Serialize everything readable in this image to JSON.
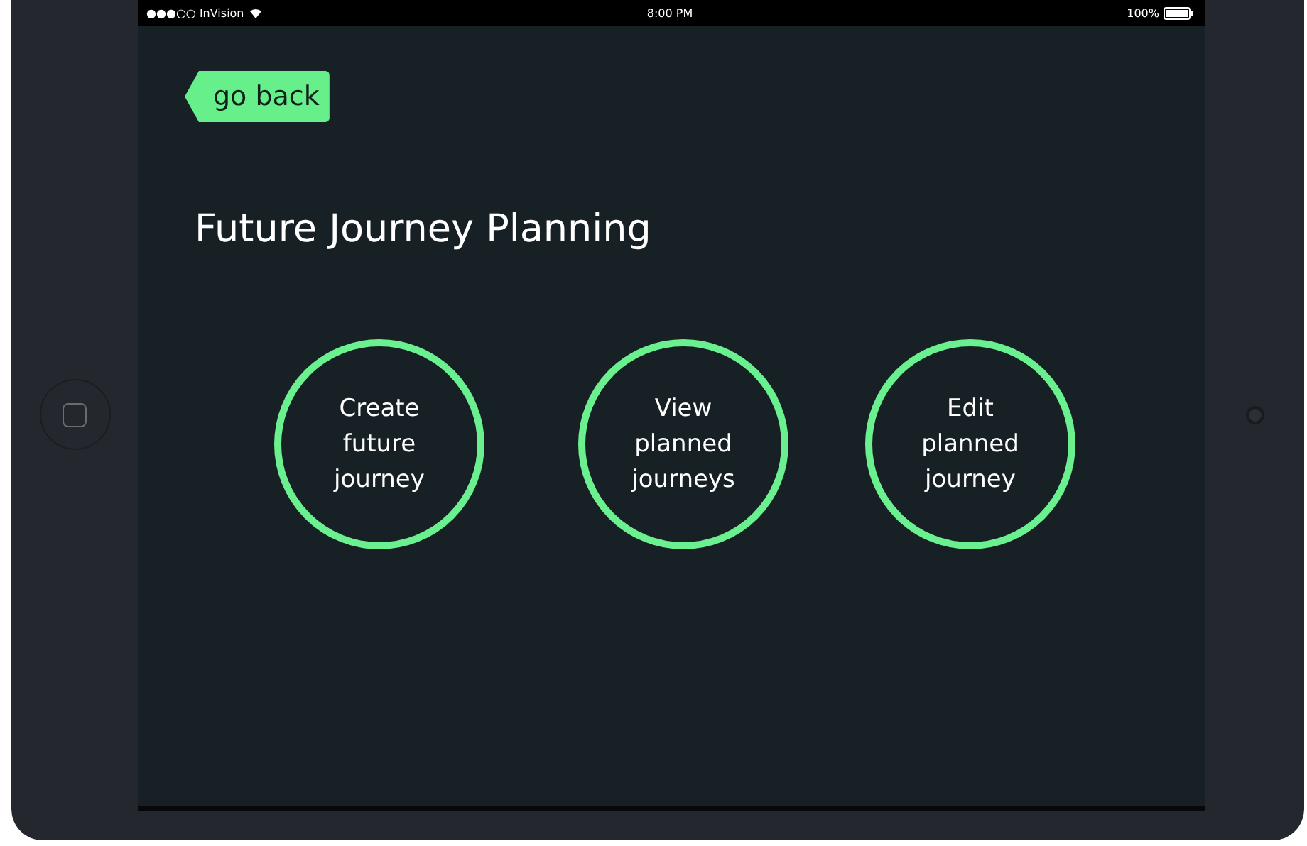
{
  "status_bar": {
    "carrier": "●●●○○ InVision",
    "time": "8:00 PM",
    "battery": "100%"
  },
  "back_button": {
    "label": "go back"
  },
  "title": "Future Journey Planning",
  "options": [
    {
      "label": "Create future journey"
    },
    {
      "label": "View planned journeys"
    },
    {
      "label": "Edit planned journey"
    }
  ]
}
